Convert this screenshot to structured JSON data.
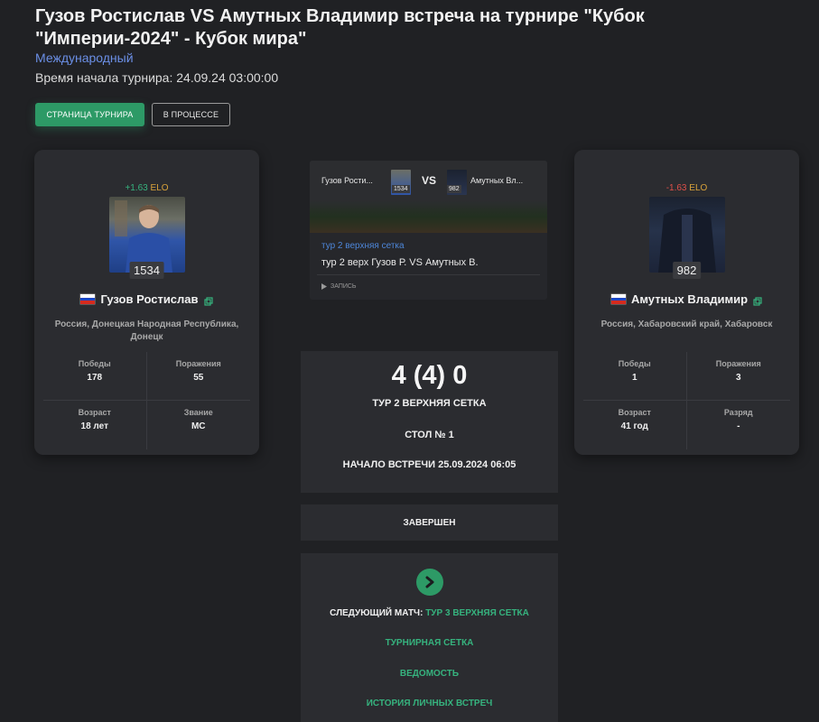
{
  "header": {
    "title": "Гузов Ростислав VS Амутных Владимир встреча на турнире \"Кубок \"Империи-2024\" - Кубок мира\"",
    "type_link": "Международный",
    "start_time": "Время начала турнира: 24.09.24 03:00:00",
    "tournament_page_label": "СТРАНИЦА ТУРНИРА",
    "status_label": "В ПРОЦЕССЕ"
  },
  "player1": {
    "elo_change": "+1.63",
    "elo_unit": "ELO",
    "rating": "1534",
    "name": "Гузов Ростислав",
    "region": "Россия, Донецкая Народная Республика, Донецк",
    "stats": [
      {
        "label": "Победы",
        "value": "178"
      },
      {
        "label": "Поражения",
        "value": "55"
      },
      {
        "label": "Возраст",
        "value": "18 лет"
      },
      {
        "label": "Звание",
        "value": "МС"
      }
    ]
  },
  "player2": {
    "elo_change": "-1.63",
    "elo_unit": "ELO",
    "rating": "982",
    "name": "Амутных Владимир",
    "region": "Россия, Хабаровский край, Хабаровск",
    "stats": [
      {
        "label": "Победы",
        "value": "1"
      },
      {
        "label": "Поражения",
        "value": "3"
      },
      {
        "label": "Возраст",
        "value": "41 год"
      },
      {
        "label": "Разряд",
        "value": "-"
      }
    ]
  },
  "video": {
    "left_name": "Гузов Рости...",
    "left_rating": "1534",
    "vs": "VS",
    "right_name": "Амутных Вл...",
    "right_rating": "982",
    "tag": "тур 2 верхняя сетка",
    "title": "тур 2 верх Гузов Р. VS Амутных В.",
    "record_label": "ЗАПИСЬ"
  },
  "match": {
    "score": "4 (4) 0",
    "round": "ТУР 2 ВЕРХНЯЯ СЕТКА",
    "table": "СТОЛ № 1",
    "start": "НАЧАЛО ВСТРЕЧИ 25.09.2024 06:05",
    "status": "ЗАВЕРШЕН"
  },
  "links": {
    "next_label": "СЛЕДУЮЩИЙ МАТЧ:",
    "next_value": "ТУР 3 ВЕРХНЯЯ СЕТКА",
    "bracket": "ТУРНИРНАЯ СЕТКА",
    "sheet": "ВЕДОМОСТЬ",
    "history": "ИСТОРИЯ ЛИЧНЫХ ВСТРЕЧ"
  },
  "colors": {
    "background": "#202124",
    "card": "#2b2c30",
    "accent_green": "#2d9a66",
    "link_blue": "#6b8fe6",
    "elo_positive": "#36b37e",
    "elo_negative": "#e0504a",
    "elo_unit": "#d9a33a"
  },
  "icons": {
    "flag": "russia-flag-icon",
    "copy": "copy-icon",
    "next": "chevron-right-icon",
    "play": "play-icon"
  }
}
